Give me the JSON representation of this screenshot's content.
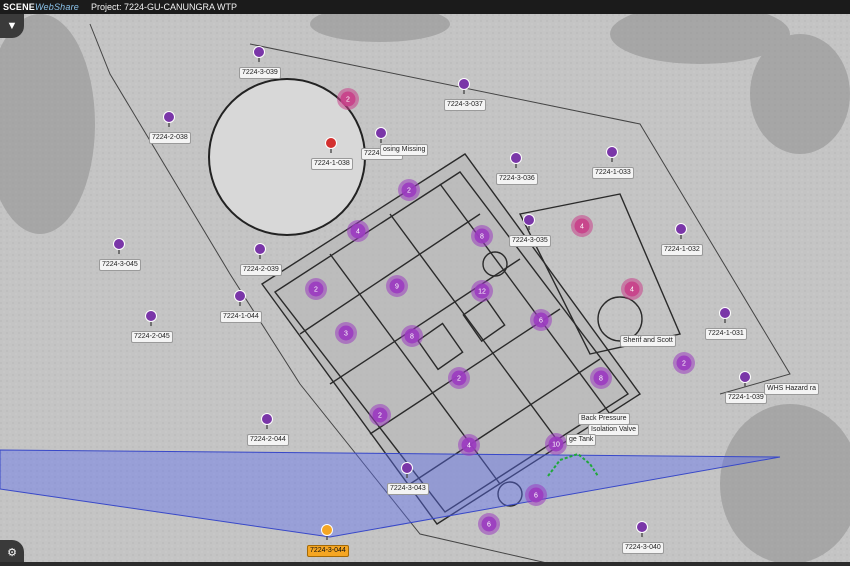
{
  "app": {
    "logo_main": "SCENE",
    "logo_sub": "WebShare",
    "project_title": "Project: 7224-GU-CANUNGRA WTP"
  },
  "icons": {
    "filter": "filter-icon",
    "settings": "gear-icon"
  },
  "colors": {
    "pin_purple": "#7a36a8",
    "pin_red": "#d3302f",
    "pin_selected": "#f5a623",
    "cluster": "#9b3cc0",
    "cluster_pink": "#c8408a",
    "viewcone": "#5a6cf0"
  },
  "markers": [
    {
      "label": "7224-3-039"
    },
    {
      "label": "7224-2-038"
    },
    {
      "label": "7224-1-038"
    },
    {
      "label": "7224-3-038"
    },
    {
      "label": "7224-3-037"
    },
    {
      "label": "7224-3-036"
    },
    {
      "label": "7224-1-033"
    },
    {
      "label": "7224-3-035"
    },
    {
      "label": "7224-1-032"
    },
    {
      "label": "7224-3-045"
    },
    {
      "label": "7224-2-039"
    },
    {
      "label": "7224-1-044"
    },
    {
      "label": "7224-2-045"
    },
    {
      "label": "7224-1-031"
    },
    {
      "label": "7224-1-039"
    },
    {
      "label": "7224-2-044"
    },
    {
      "label": "7224-3-043"
    },
    {
      "label": "7224-3-044"
    },
    {
      "label": "7224-3-040"
    }
  ],
  "annotations": [
    {
      "label": "osing Missing"
    },
    {
      "label": "Sherif and Scott"
    },
    {
      "label": "WHS Hazard ra"
    },
    {
      "label": "Back Pressure"
    },
    {
      "label": "Isolation Valve"
    },
    {
      "label": "ge Tank"
    }
  ],
  "clusters": [
    {
      "count": "2"
    },
    {
      "count": "2"
    },
    {
      "count": "4"
    },
    {
      "count": "8"
    },
    {
      "count": "4"
    },
    {
      "count": "2"
    },
    {
      "count": "9"
    },
    {
      "count": "12"
    },
    {
      "count": "4"
    },
    {
      "count": "3"
    },
    {
      "count": "8"
    },
    {
      "count": "6"
    },
    {
      "count": "2"
    },
    {
      "count": "8"
    },
    {
      "count": "2"
    },
    {
      "count": "2"
    },
    {
      "count": "4"
    },
    {
      "count": "10"
    },
    {
      "count": "6"
    },
    {
      "count": "6"
    }
  ]
}
